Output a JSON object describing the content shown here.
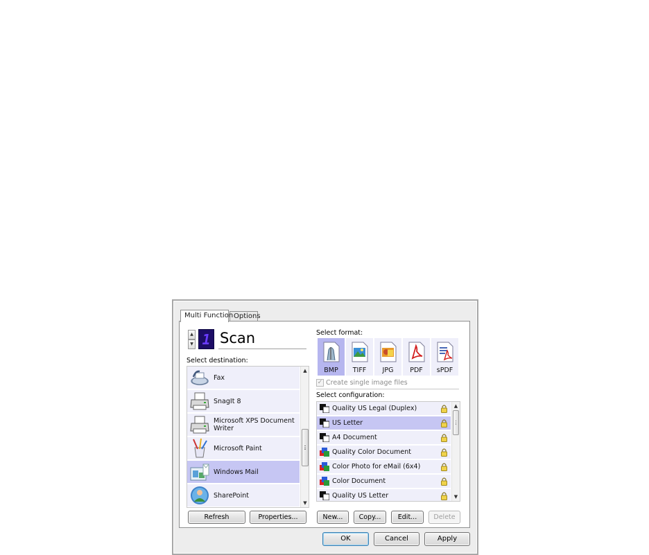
{
  "tabs": [
    {
      "label": "Multi Function",
      "active": true
    },
    {
      "label": "Options",
      "active": false
    }
  ],
  "function": {
    "number": "1",
    "name": "Scan"
  },
  "destination": {
    "label": "Select destination:",
    "items": [
      {
        "label": "Fax",
        "icon": "fax-icon",
        "selected": false
      },
      {
        "label": "SnagIt 8",
        "icon": "printer-icon",
        "selected": false
      },
      {
        "label": "Microsoft XPS Document Writer",
        "icon": "printer-icon",
        "selected": false
      },
      {
        "label": "Microsoft Paint",
        "icon": "paint-icon",
        "selected": false
      },
      {
        "label": "Windows Mail",
        "icon": "windows-mail-icon",
        "selected": true
      },
      {
        "label": "SharePoint",
        "icon": "sharepoint-icon",
        "selected": false
      }
    ],
    "refresh_button": "Refresh",
    "properties_button": "Properties..."
  },
  "format": {
    "label": "Select format:",
    "items": [
      {
        "label": "BMP",
        "icon": "bmp-file-icon",
        "selected": true
      },
      {
        "label": "TIFF",
        "icon": "tiff-file-icon",
        "selected": false
      },
      {
        "label": "JPG",
        "icon": "jpg-file-icon",
        "selected": false
      },
      {
        "label": "PDF",
        "icon": "pdf-file-icon",
        "selected": false
      },
      {
        "label": "sPDF",
        "icon": "spdf-file-icon",
        "selected": false
      }
    ],
    "single_image_label": "Create single image files",
    "single_image_checked": true
  },
  "configuration": {
    "label": "Select configuration:",
    "items": [
      {
        "label": "Quality US Legal (Duplex)",
        "icon": "bw-config-icon",
        "selected": false
      },
      {
        "label": "US Letter",
        "icon": "bw-config-icon",
        "selected": true
      },
      {
        "label": "A4 Document",
        "icon": "bw-config-icon",
        "selected": false
      },
      {
        "label": "Quality Color Document",
        "icon": "color-config-icon",
        "selected": false
      },
      {
        "label": "Color Photo for eMail (6x4)",
        "icon": "color-config-icon",
        "selected": false
      },
      {
        "label": "Color Document",
        "icon": "color-config-icon",
        "selected": false
      },
      {
        "label": "Quality US Letter",
        "icon": "bw-config-icon",
        "selected": false
      }
    ],
    "new_button": "New...",
    "copy_button": "Copy...",
    "edit_button": "Edit...",
    "delete_button": "Delete"
  },
  "dialog": {
    "ok_button": "OK",
    "cancel_button": "Cancel",
    "apply_button": "Apply"
  },
  "colors": {
    "selection": "#c6c6f3",
    "item_background": "#efeffa",
    "counter_background": "#1d0d66"
  }
}
